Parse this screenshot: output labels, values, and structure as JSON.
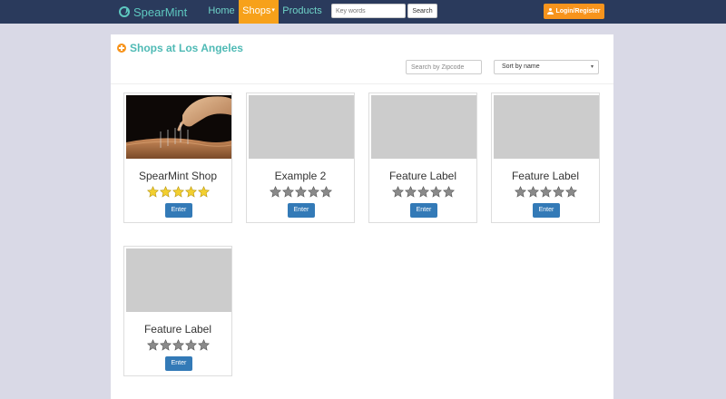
{
  "nav": {
    "brand": "SpearMint",
    "home": "Home",
    "shops": "Shops",
    "products": "Products",
    "search_placeholder": "Key words",
    "search_button": "Search",
    "login": "Login/Register"
  },
  "page": {
    "title": "Shops at Los Angeles",
    "zip_placeholder": "Search by Zipcode",
    "sort_selected": "Sort by name"
  },
  "shops": [
    {
      "name": "SpearMint Shop",
      "rating": 5,
      "max_rating": 5,
      "button": "Enter",
      "has_image": true
    },
    {
      "name": "Example 2",
      "rating": 0,
      "max_rating": 5,
      "button": "Enter",
      "has_image": false
    },
    {
      "name": "Feature Label",
      "rating": 0,
      "max_rating": 5,
      "button": "Enter",
      "has_image": false
    },
    {
      "name": "Feature Label",
      "rating": 0,
      "max_rating": 5,
      "button": "Enter",
      "has_image": false
    },
    {
      "name": "Feature Label",
      "rating": 0,
      "max_rating": 5,
      "button": "Enter",
      "has_image": false
    }
  ],
  "colors": {
    "topbar": "#2a3a5c",
    "accent_orange": "#f7941d",
    "brand_teal": "#5ec8c0",
    "enter_blue": "#337ab7",
    "star_filled": "#f2cf2f",
    "star_empty": "#8a8a8a"
  }
}
